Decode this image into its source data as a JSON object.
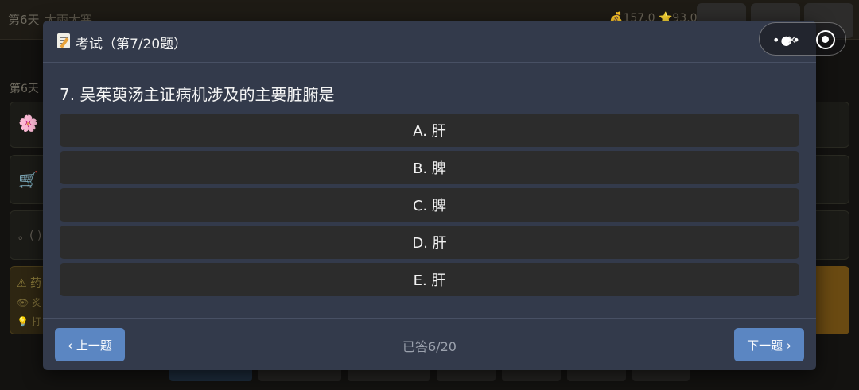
{
  "background": {
    "day": "第6天",
    "weather": "大雨大寒",
    "stats": "💰157.0 ⭐93.0",
    "section_label": "第6天",
    "cards": [
      {
        "icon": "cherry-blossom-icon",
        "glyph": "🌸"
      },
      {
        "icon": "cart-icon",
        "glyph": "🛒"
      },
      {
        "icon": "emoticon-icon",
        "glyph": "。( )"
      }
    ],
    "warning": {
      "line1": "⚠ 药",
      "line2": "👁 炙",
      "line3": "💡 打"
    }
  },
  "exam": {
    "title": "考试（第7/20题）",
    "question": "7. 吴茱萸汤主证病机涉及的主要脏腑是",
    "options": [
      "A. 肝",
      "B. 脾",
      "C. 脾",
      "D. 肝",
      "E. 肝"
    ],
    "prev_label": "‹ 上一题",
    "next_label": "下一题 ›",
    "progress": "已答6/20"
  },
  "capsule": {
    "more_glyph": "•●•",
    "close_glyph": "×"
  },
  "colors": {
    "modal_bg": "#333a4b",
    "option_bg": "#2c2c2c",
    "button_accent": "#5b86c2"
  }
}
